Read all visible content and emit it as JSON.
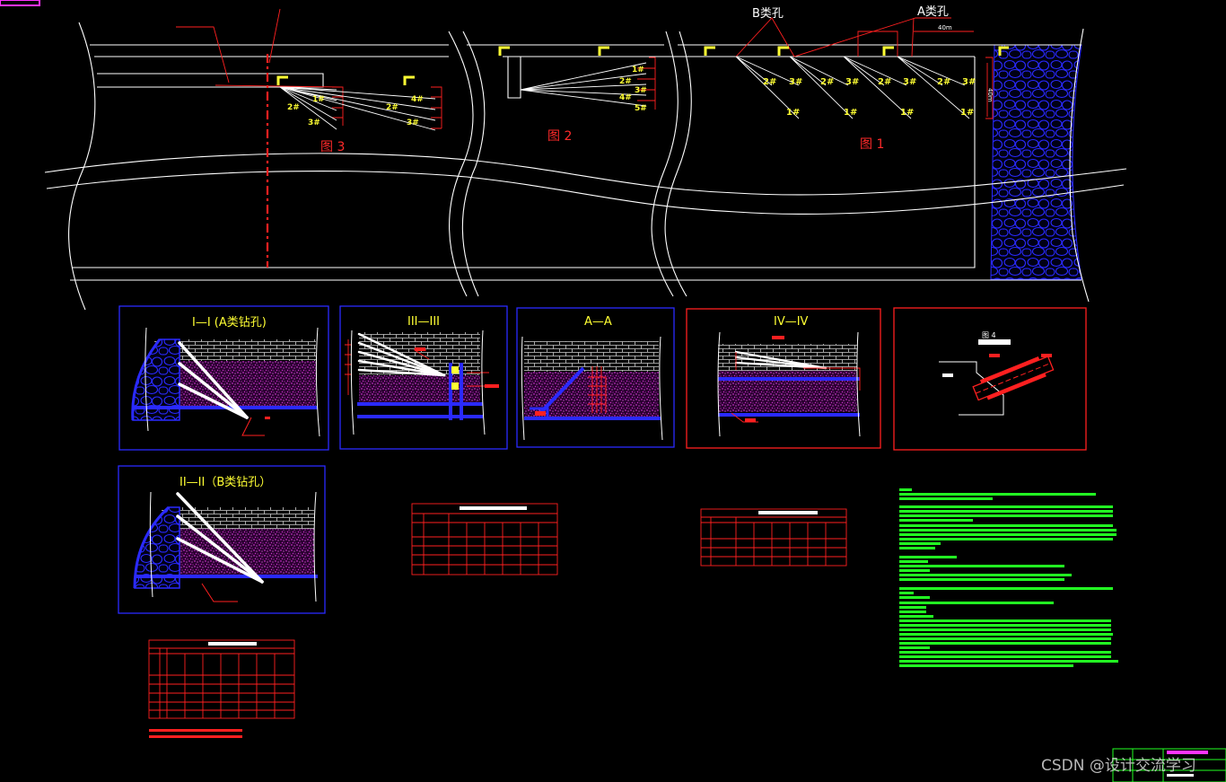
{
  "drawing": {
    "plan_labels": {
      "fig1": "图  1",
      "fig2": "图  2",
      "fig3": "图  3",
      "b_holes": "B类孔",
      "a_holes": "A类孔",
      "dim_40m_a": "40m",
      "dim_40m_b": "40m"
    },
    "hole_labels_fig1": [
      "2#",
      "3#",
      "1#",
      "2#",
      "3#",
      "1#",
      "2#",
      "3#",
      "1#",
      "2#",
      "3#",
      "1#"
    ],
    "hole_labels_fig2": [
      "1#",
      "2#",
      "3#",
      "4#",
      "5#"
    ],
    "hole_labels_fig3": [
      "1#",
      "2#",
      "3#",
      "4#",
      "2#",
      "3#"
    ],
    "sections": {
      "s1": "I—I (A类钻孔)",
      "s2": "II—II（B类钻孔）",
      "s3": "III—III",
      "s4": "A—A",
      "s5": "IV—IV",
      "s6": "图  4"
    }
  },
  "watermark": "CSDN @设计交流学习",
  "colors": {
    "background": "#000000",
    "outline": "#ffffff",
    "label": "#ffff33",
    "leader": "#ff2a2a",
    "section_frame_blue": "#2a2aff",
    "section_frame_red": "#ff2020",
    "coal": "#ff33ff",
    "notes": "#22ff22"
  }
}
